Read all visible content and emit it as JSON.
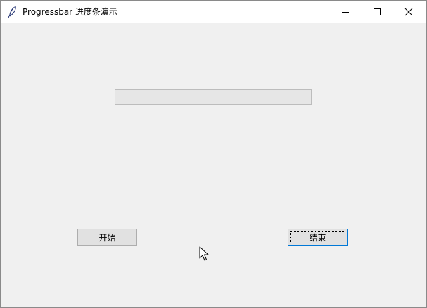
{
  "window": {
    "title": "Progressbar 进度条演示",
    "controls": {
      "minimize_icon": "minimize-icon",
      "maximize_icon": "maximize-icon",
      "close_icon": "close-icon"
    }
  },
  "progressbar": {
    "value_percent": 0
  },
  "buttons": {
    "start_label": "开始",
    "end_label": "结束"
  },
  "colors": {
    "progress_fill": "#06b025",
    "focus_border": "#0078d7"
  }
}
